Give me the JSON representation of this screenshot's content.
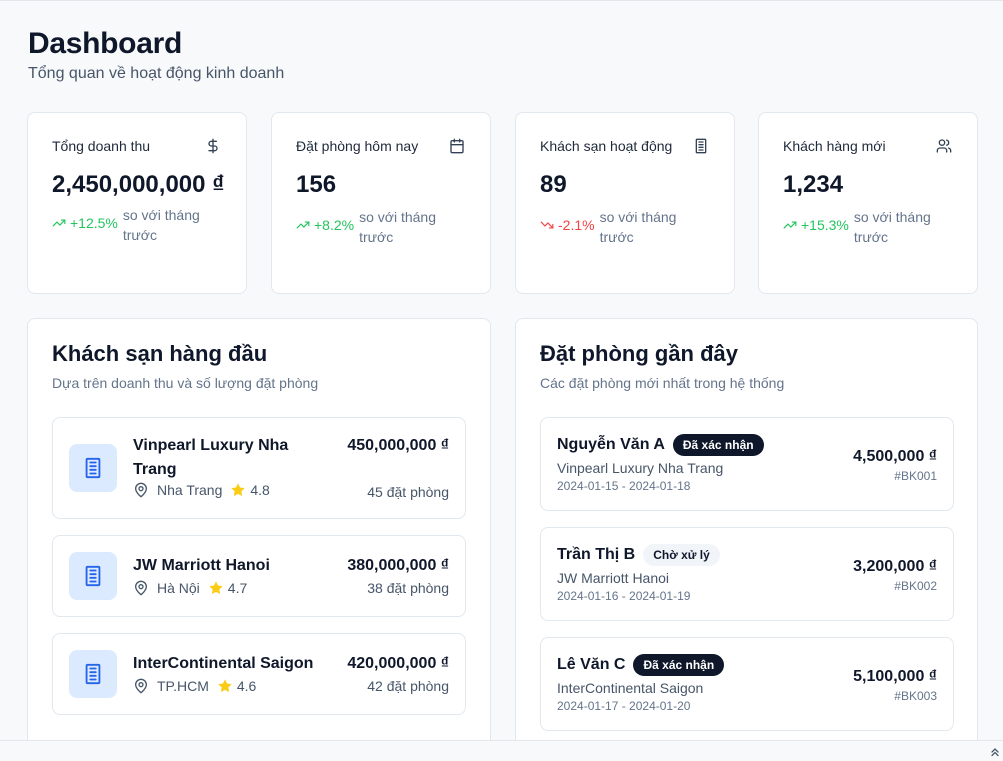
{
  "header": {
    "title": "Dashboard",
    "subtitle": "Tổng quan về hoạt động kinh doanh"
  },
  "stats": [
    {
      "label": "Tổng doanh thu",
      "value": "2,450,000,000 ₫",
      "trend": "+12.5%",
      "direction": "up",
      "compare": "so với tháng trước",
      "icon": "dollar-icon"
    },
    {
      "label": "Đặt phòng hôm nay",
      "value": "156",
      "trend": "+8.2%",
      "direction": "up",
      "compare": "so với tháng trước",
      "icon": "calendar-icon"
    },
    {
      "label": "Khách sạn hoạt động",
      "value": "89",
      "trend": "-2.1%",
      "direction": "down",
      "compare": "so với tháng trước",
      "icon": "building-icon"
    },
    {
      "label": "Khách hàng mới",
      "value": "1,234",
      "trend": "+15.3%",
      "direction": "up",
      "compare": "so với tháng trước",
      "icon": "users-icon"
    }
  ],
  "top_hotels": {
    "title": "Khách sạn hàng đầu",
    "subtitle": "Dựa trên doanh thu và số lượng đặt phòng",
    "items": [
      {
        "name": "Vinpearl Luxury Nha Trang",
        "location": "Nha Trang",
        "rating": "4.8",
        "revenue": "450,000,000 ₫",
        "bookings": "45 đặt phòng"
      },
      {
        "name": "JW Marriott Hanoi",
        "location": "Hà Nội",
        "rating": "4.7",
        "revenue": "380,000,000 ₫",
        "bookings": "38 đặt phòng"
      },
      {
        "name": "InterContinental Saigon",
        "location": "TP.HCM",
        "rating": "4.6",
        "revenue": "420,000,000 ₫",
        "bookings": "42 đặt phòng"
      }
    ]
  },
  "recent_bookings": {
    "title": "Đặt phòng gần đây",
    "subtitle": "Các đặt phòng mới nhất trong hệ thống",
    "items": [
      {
        "customer": "Nguyễn Văn A",
        "status": "Đã xác nhận",
        "status_style": "dark",
        "hotel": "Vinpearl Luxury Nha Trang",
        "dates": "2024-01-15 - 2024-01-18",
        "amount": "4,500,000 ₫",
        "code": "#BK001"
      },
      {
        "customer": "Trần Thị B",
        "status": "Chờ xử lý",
        "status_style": "light",
        "hotel": "JW Marriott Hanoi",
        "dates": "2024-01-16 - 2024-01-19",
        "amount": "3,200,000 ₫",
        "code": "#BK002"
      },
      {
        "customer": "Lê Văn C",
        "status": "Đã xác nhận",
        "status_style": "dark",
        "hotel": "InterContinental Saigon",
        "dates": "2024-01-17 - 2024-01-20",
        "amount": "5,100,000 ₫",
        "code": "#BK003"
      }
    ]
  },
  "colors": {
    "up": "#22c55e",
    "down": "#ef4444",
    "accent": "#2563eb",
    "thumb_bg": "#dbeafe",
    "star": "#facc15"
  },
  "scroll_icon": "chevron-up-double-icon"
}
